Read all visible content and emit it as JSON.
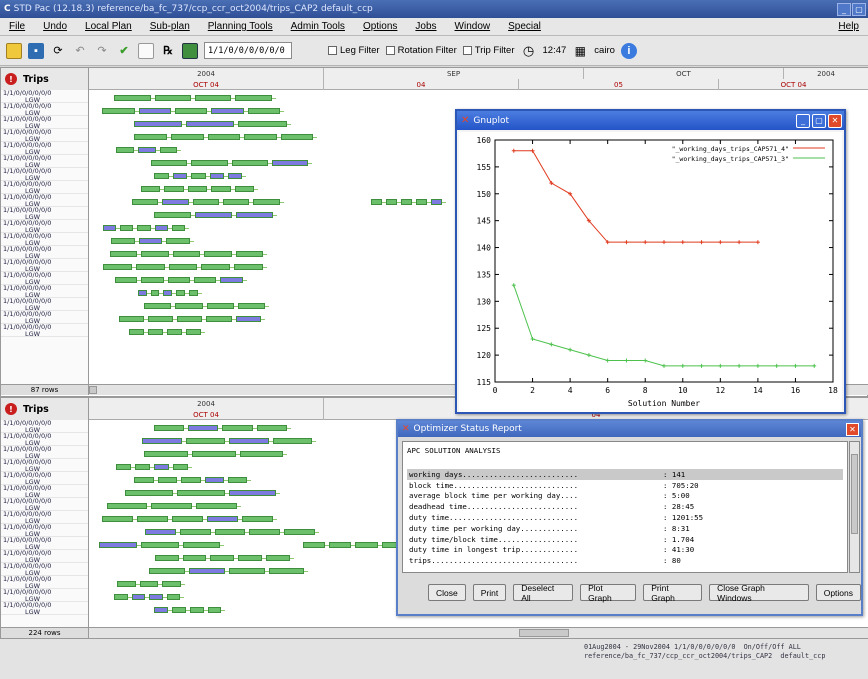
{
  "window": {
    "title": "STD Pac (12.18.3)    reference/ba_fc_737/ccp_ccr_oct2004/trips_CAP2    default_ccp",
    "controls": [
      "_",
      "▢"
    ]
  },
  "menu": [
    "File",
    "Undo",
    "Local Plan",
    "Sub-plan",
    "Planning Tools",
    "Admin Tools",
    "Options",
    "Jobs",
    "Window",
    "Special"
  ],
  "menu_help": "Help",
  "toolbar": {
    "rule_field": "1/1/0/0/0/0/0/0",
    "leg_filter": "Leg Filter",
    "rotation_filter": "Rotation Filter",
    "trip_filter": "Trip Filter",
    "time": "12:47",
    "airport": "cairo",
    "colors": {
      "save": "#2f6db3",
      "check": "#3a9c2a",
      "calendar": "#3f8f3f",
      "info": "#3b7be0"
    }
  },
  "top_panel": {
    "label": "Trips",
    "year_row": [
      "2004",
      "SEP",
      "OCT",
      "2004"
    ],
    "day_row": [
      "OCT 04",
      "04",
      "05",
      "OCT 04"
    ],
    "row_labels": [
      "1/1/0/0/0/0/0/0",
      "1/1/0/0/0/0/0/0",
      "1/1/0/0/0/0/0/0",
      "1/1/0/0/0/0/0/0",
      "1/1/0/0/0/0/0/0",
      "1/1/0/0/0/0/0/0",
      "1/1/0/0/0/0/0/0",
      "1/1/0/0/0/0/0/0",
      "1/1/0/0/0/0/0/0",
      "1/1/0/0/0/0/0/0",
      "1/1/0/0/0/0/0/0",
      "1/1/0/0/0/0/0/0",
      "1/1/0/0/0/0/0/0",
      "1/1/0/0/0/0/0/0",
      "1/1/0/0/0/0/0/0",
      "1/1/0/0/0/0/0/0",
      "1/1/0/0/0/0/0/0",
      "1/1/0/0/0/0/0/0",
      "1/1/0/0/0/0/0/0"
    ],
    "base": "LGW",
    "rows_count": "87 rows"
  },
  "bottom_panel": {
    "label": "Trips",
    "year_row": [
      "2004",
      "SEP"
    ],
    "day_row": [
      "OCT 04",
      "04"
    ],
    "row_labels": [
      "1/1/0/0/0/0/0/0",
      "1/1/0/0/0/0/0/0",
      "1/1/0/0/0/0/0/0",
      "1/1/0/0/0/0/0/0",
      "1/1/0/0/0/0/0/0",
      "1/1/0/0/0/0/0/0",
      "1/1/0/0/0/0/0/0",
      "1/1/0/0/0/0/0/0",
      "1/1/0/0/0/0/0/0",
      "1/1/0/0/0/0/0/0",
      "1/1/0/0/0/0/0/0",
      "1/1/0/0/0/0/0/0",
      "1/1/0/0/0/0/0/0",
      "1/1/0/0/0/0/0/0",
      "1/1/0/0/0/0/0/0"
    ],
    "base": "LGW",
    "rows_count": "224 rows"
  },
  "gnuplot": {
    "title": "Gnuplot",
    "legend": [
      "\"_working_days_trips_CAP571_4\"",
      "\"_working_days_trips_CAP571_3\""
    ],
    "xlabel": "Solution Number",
    "x_ticks": [
      "0",
      "2",
      "4",
      "6",
      "8",
      "10",
      "12",
      "14",
      "16",
      "18"
    ],
    "y_ticks": [
      "115",
      "120",
      "125",
      "130",
      "135",
      "140",
      "145",
      "150",
      "155",
      "160"
    ],
    "series_colors": [
      "#e03a1e",
      "#4cc24c"
    ]
  },
  "chart_data": {
    "type": "line",
    "title": "",
    "xlabel": "Solution Number",
    "ylabel": "",
    "xlim": [
      0,
      18
    ],
    "ylim": [
      115,
      160
    ],
    "grid": false,
    "legend_position": "top-right",
    "series": [
      {
        "name": "\"_working_days_trips_CAP571_4\"",
        "x": [
          1,
          2,
          3,
          4,
          5,
          6,
          7,
          8,
          9,
          10,
          11,
          12,
          13,
          14
        ],
        "values": [
          158,
          158,
          152,
          150,
          145,
          141,
          141,
          141,
          141,
          141,
          141,
          141,
          141,
          141
        ]
      },
      {
        "name": "\"_working_days_trips_CAP571_3\"",
        "x": [
          1,
          2,
          3,
          4,
          5,
          6,
          7,
          8,
          9,
          10,
          11,
          12,
          13,
          14,
          15,
          16,
          17
        ],
        "values": [
          133,
          123,
          122,
          121,
          120,
          119,
          119,
          119,
          118,
          118,
          118,
          118,
          118,
          118,
          118,
          118,
          118
        ]
      }
    ]
  },
  "optimizer": {
    "title": "Optimizer Status Report",
    "heading": "APC SOLUTION ANALYSIS",
    "lines": [
      {
        "label": "working days..........................",
        "value": ": 141"
      },
      {
        "label": "block time............................",
        "value": ": 705:20"
      },
      {
        "label": "average block time per working day....",
        "value": ": 5:00"
      },
      {
        "label": "deadhead time.........................",
        "value": ": 28:45"
      },
      {
        "label": "duty time.............................",
        "value": ": 1201:55"
      },
      {
        "label": "duty time per working day.............",
        "value": ": 8:31"
      },
      {
        "label": "duty time/block time..................",
        "value": ": 1.704"
      },
      {
        "label": "duty time in longest trip.............",
        "value": ": 41:30"
      },
      {
        "label": "trips.................................",
        "value": ": 80"
      }
    ],
    "buttons": [
      "Close",
      "Print",
      "Deselect All",
      "Plot Graph",
      "Print Graph",
      "Close Graph Windows",
      "Options"
    ]
  },
  "status": {
    "line1": "01Aug2004 - 29Nov2004 1/1/0/0/0/0/0/0  On/Off/Off ALL",
    "line2": "reference/ba_fc_737/ccp_ccr_oct2004/trips_CAP2  default_ccp"
  }
}
